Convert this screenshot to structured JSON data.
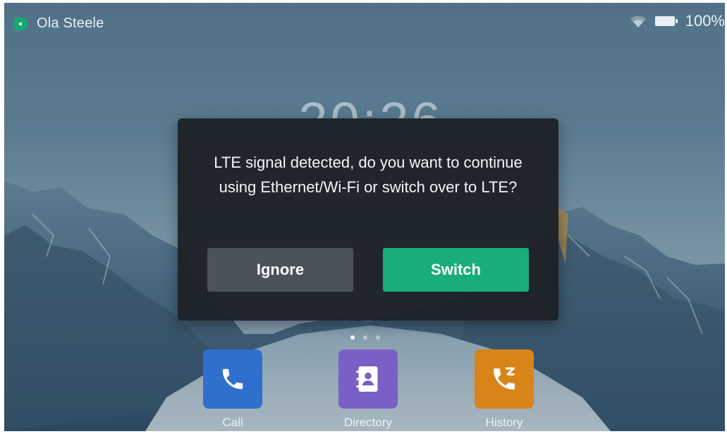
{
  "status_bar": {
    "account_name": "Ola Steele",
    "battery_text": "100%",
    "icons": [
      "account-status-icon",
      "wifi-icon",
      "battery-icon"
    ]
  },
  "clock": {
    "time": "20:26"
  },
  "dialog": {
    "message": "LTE signal detected, do you want to continue using Ethernet/Wi-Fi or switch over to LTE?",
    "ignore_label": "Ignore",
    "switch_label": "Switch"
  },
  "pager": {
    "pages": 3,
    "active_index": 0
  },
  "apps": [
    {
      "label": "Call",
      "icon": "phone-icon",
      "color": "#2f6fce"
    },
    {
      "label": "Directory",
      "icon": "contact-book-icon",
      "color": "#7a5fc6"
    },
    {
      "label": "History",
      "icon": "call-history-icon",
      "color": "#d98418"
    }
  ],
  "colors": {
    "accent_green": "#1aad7c",
    "dialog_bg": "#1c2126",
    "ignore_button": "#4b5259"
  }
}
